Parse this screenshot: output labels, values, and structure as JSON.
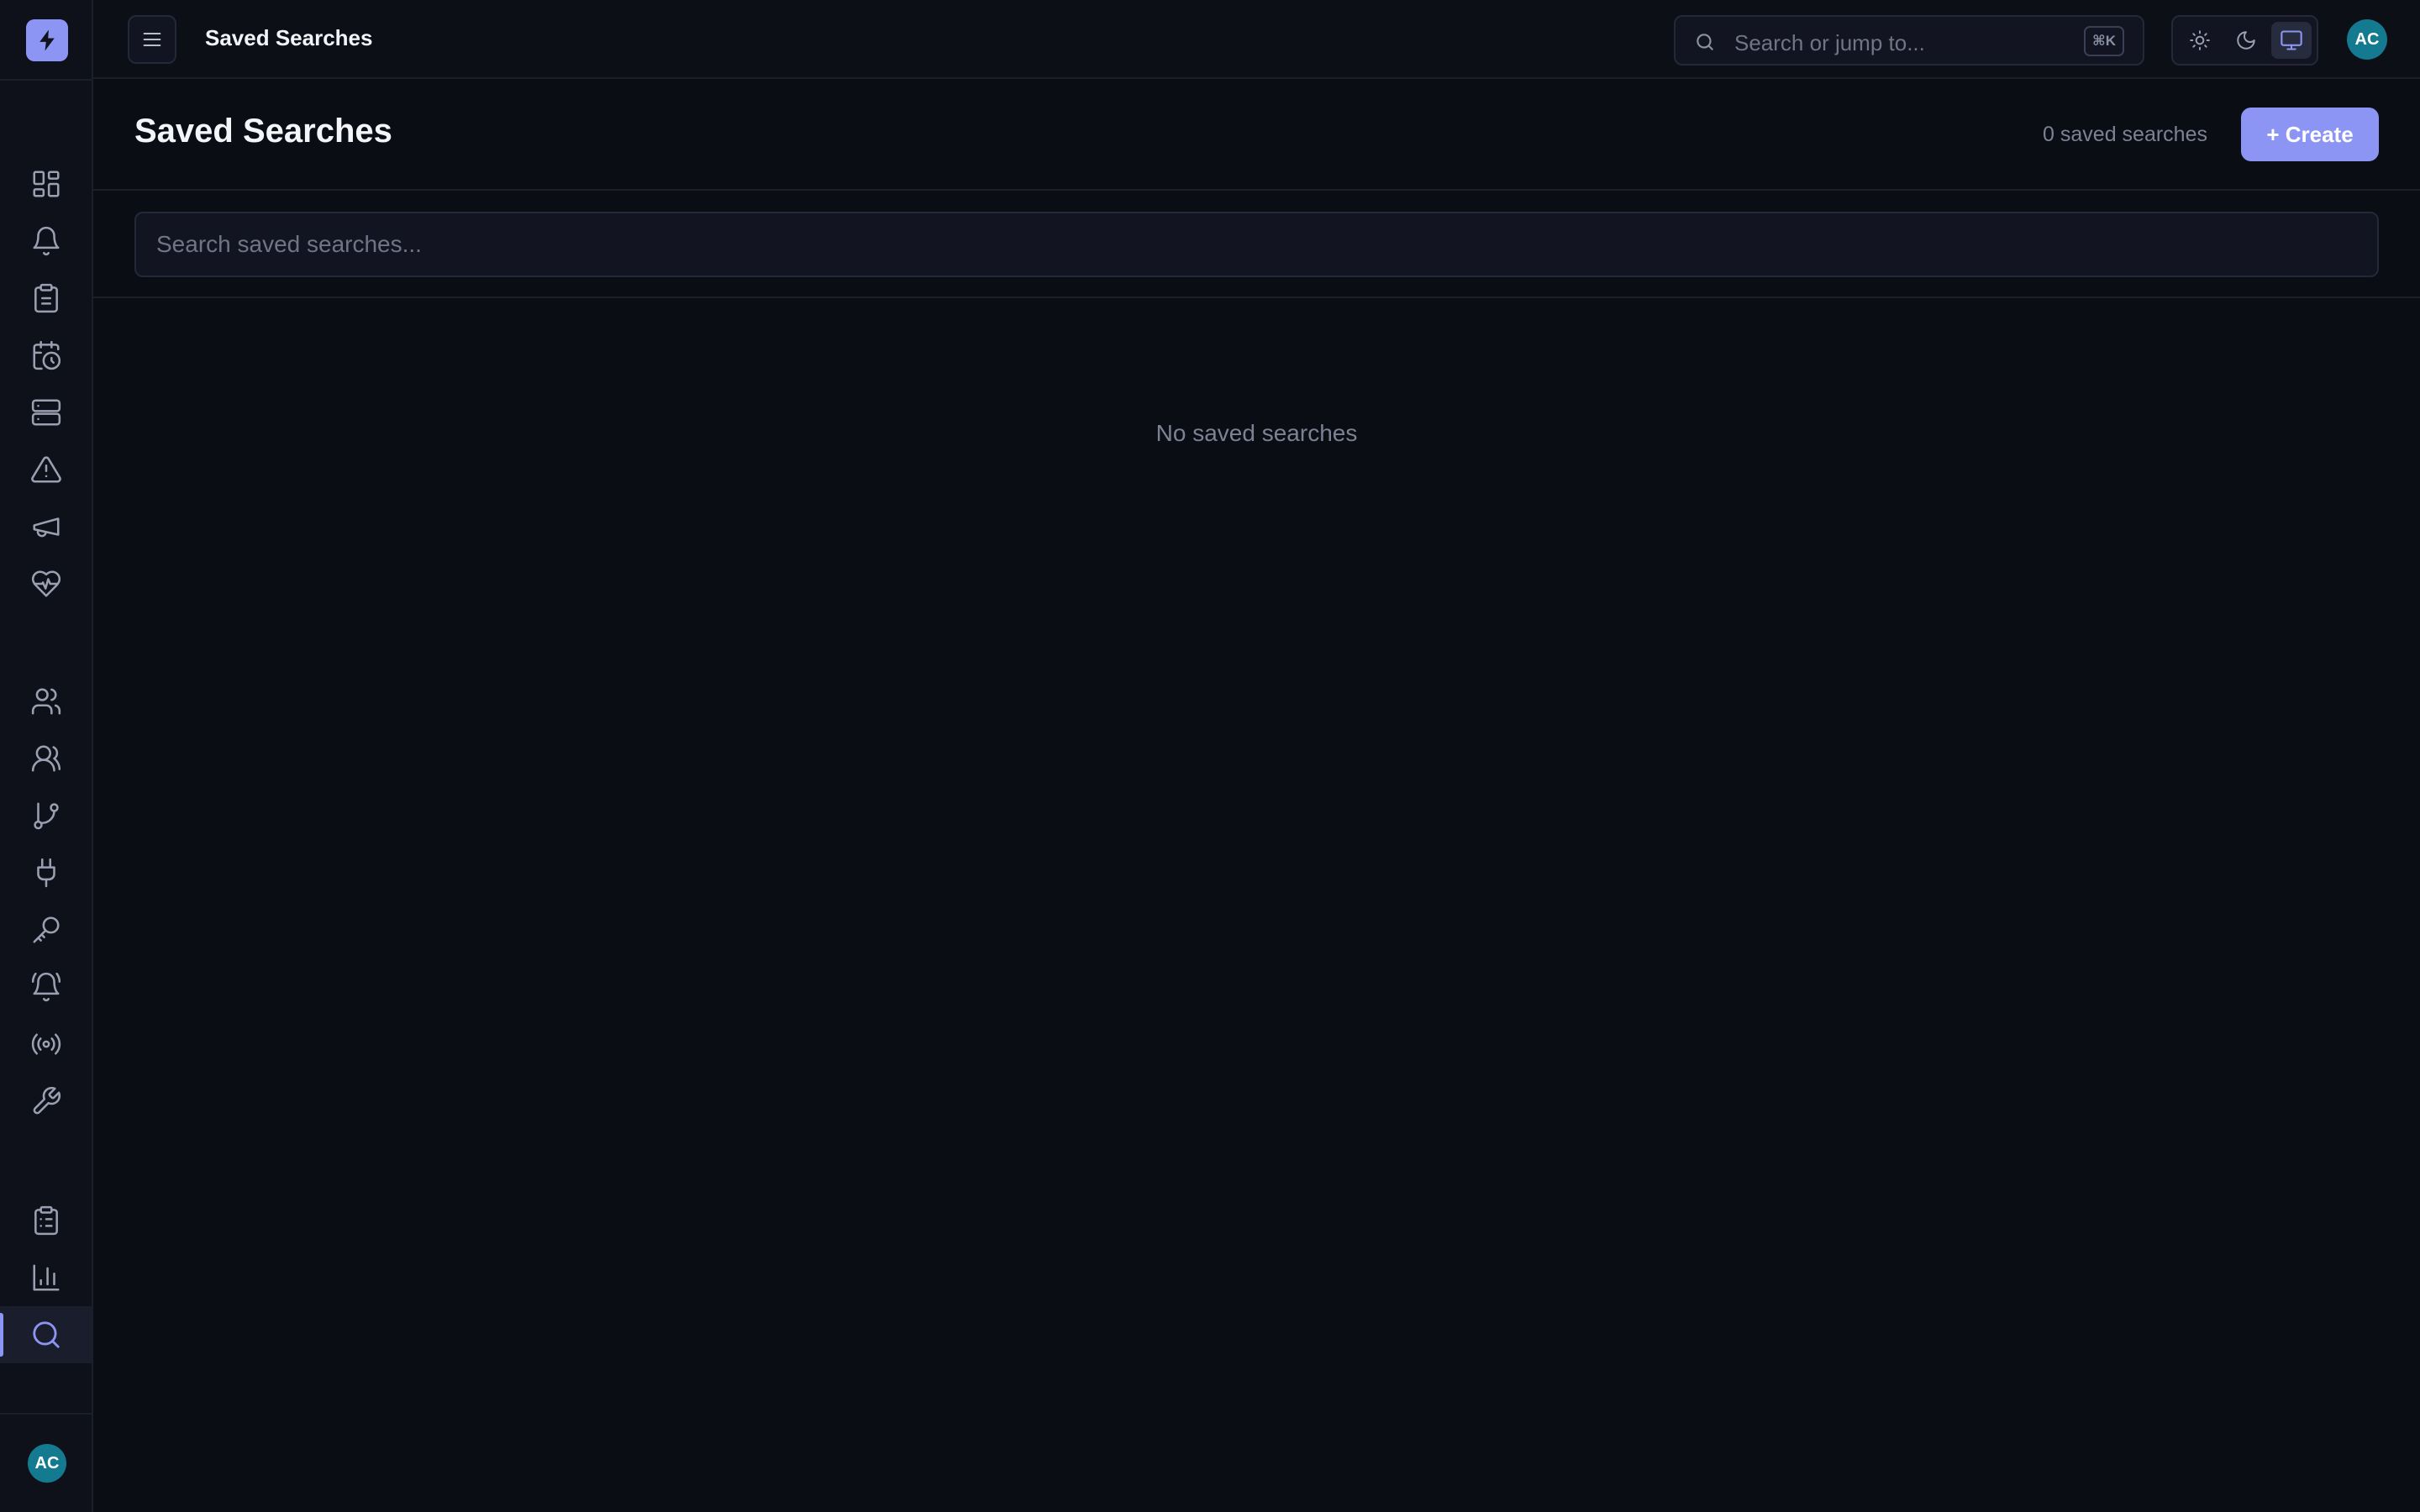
{
  "topbar": {
    "title": "Saved Searches",
    "search_placeholder": "Search or jump to...",
    "shortcut": "⌘K",
    "user_initials": "AC"
  },
  "sidebar": {
    "user_initials": "AC",
    "items": [
      {
        "icon": "dashboard-icon"
      },
      {
        "icon": "bell-icon"
      },
      {
        "icon": "clipboard-icon"
      },
      {
        "icon": "calendar-clock-icon"
      },
      {
        "icon": "server-icon"
      },
      {
        "icon": "alert-triangle-icon"
      },
      {
        "icon": "megaphone-icon"
      },
      {
        "icon": "heart-pulse-icon"
      },
      {
        "icon": "user-icon"
      },
      {
        "icon": "users-icon"
      },
      {
        "icon": "git-branch-icon"
      },
      {
        "icon": "plug-icon"
      },
      {
        "icon": "key-icon"
      },
      {
        "icon": "bell-ring-icon"
      },
      {
        "icon": "radio-icon"
      },
      {
        "icon": "wrench-icon"
      },
      {
        "icon": "clipboard-list-icon"
      },
      {
        "icon": "bar-chart-icon"
      },
      {
        "icon": "search-icon",
        "active": true
      }
    ]
  },
  "page": {
    "title": "Saved Searches",
    "count_label": "0 saved searches",
    "create_label": "+ Create",
    "filter_placeholder": "Search saved searches...",
    "empty_message": "No saved searches"
  },
  "colors": {
    "accent": "#8d95f4",
    "avatar": "#137a8f",
    "background": "#0b0d14"
  }
}
